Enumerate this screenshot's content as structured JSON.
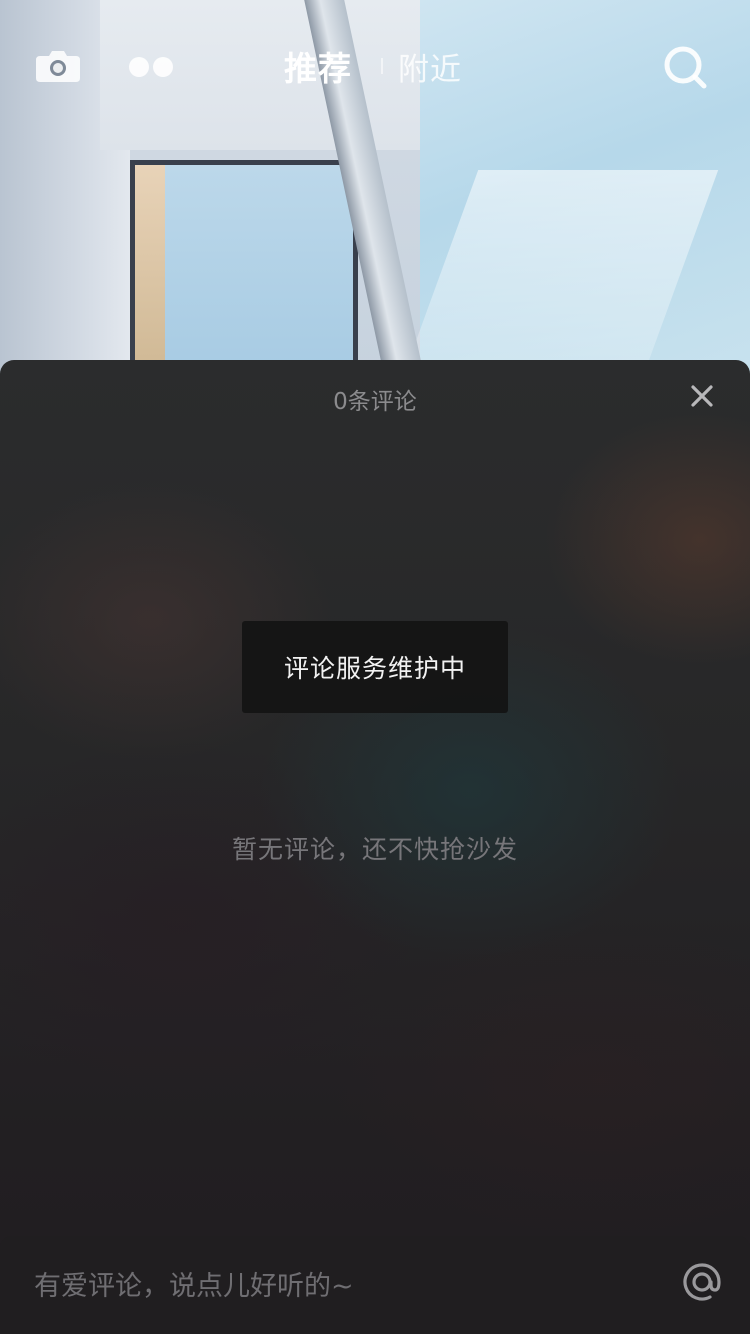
{
  "top_nav": {
    "tab_recommend": "推荐",
    "tab_nearby": "附近",
    "left_icons": [
      "camera-icon",
      "dots-icon"
    ],
    "right_icons": [
      "search-icon"
    ]
  },
  "comment_sheet": {
    "count_label": "0条评论",
    "toast_message": "评论服务维护中",
    "empty_message": "暂无评论，还不快抢沙发",
    "close_icon": "close-icon"
  },
  "input_bar": {
    "placeholder": "有爱评论，说点儿好听的~",
    "value": "",
    "at_icon": "at-icon"
  },
  "colors": {
    "sheet_background": "#272728",
    "toast_background": "#141414",
    "muted_text": "#8b8b8d",
    "placeholder_text": "#6f6e72"
  }
}
